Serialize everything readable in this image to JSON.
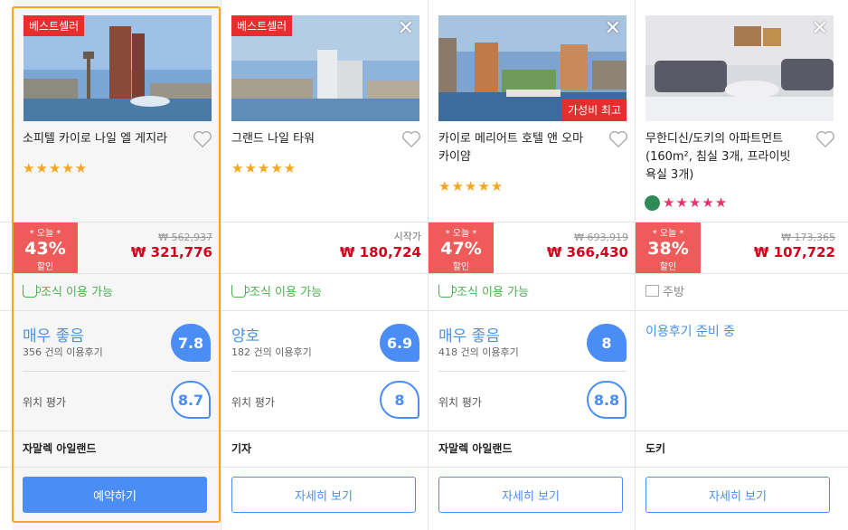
{
  "hotels": [
    {
      "best_badge": "베스트셀러",
      "name": "소피텔 카이로 나일 엘 게지라",
      "stars": "★★★★★",
      "discount_top": "* 오늘 *",
      "discount_pct": "43%",
      "discount_bottom": "할인",
      "old_price": "₩ 562,937",
      "price": "₩ 321,776",
      "amenity": "조식 이용 가능",
      "rating_label": "매우 좋음",
      "review_count": "356 건의 이용후기",
      "rating_score": "7.8",
      "location_label": "위치 평가",
      "location_score": "8.7",
      "area": "자말렉 아일랜드",
      "button": "예약하기"
    },
    {
      "best_badge": "베스트셀러",
      "name": "그랜드 나일 타워",
      "stars": "★★★★★",
      "start_label": "시작가",
      "price": "₩ 180,724",
      "amenity": "조식 이용 가능",
      "rating_label": "양호",
      "review_count": "182 건의 이용후기",
      "rating_score": "6.9",
      "location_label": "위치 평가",
      "location_score": "8",
      "area": "기자",
      "button": "자세히 보기"
    },
    {
      "value_badge": "가성비 최고",
      "name": "카이로 메리어트 호텔 앤 오마 카이얌",
      "stars": "★★★★★",
      "discount_top": "* 오늘 *",
      "discount_pct": "47%",
      "discount_bottom": "할인",
      "old_price": "₩ 693,919",
      "price": "₩ 366,430",
      "amenity": "조식 이용 가능",
      "rating_label": "매우 좋음",
      "review_count": "418 건의 이용후기",
      "rating_score": "8",
      "location_label": "위치 평가",
      "location_score": "8.8",
      "area": "자말렉 아일랜드",
      "button": "자세히 보기"
    },
    {
      "name": "무한디신/도키의 아파트먼트 (160m², 침실 3개, 프라이빗 욕실 3개)",
      "stars": "★★★★★",
      "discount_top": "* 오늘 *",
      "discount_pct": "38%",
      "discount_bottom": "할인",
      "old_price": "₩ 173,365",
      "price": "₩ 107,722",
      "amenity": "주방",
      "rating_pending": "이용후기 준비 중",
      "area": "도키",
      "button": "자세히 보기"
    }
  ],
  "close_glyph": "✕"
}
